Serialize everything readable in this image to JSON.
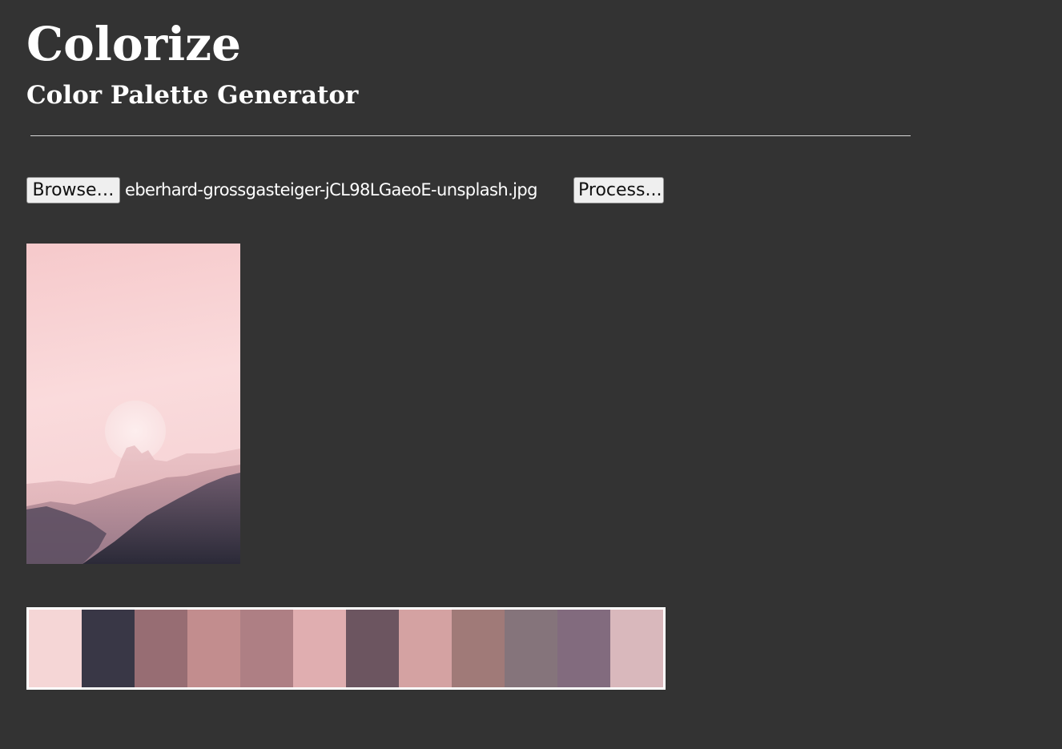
{
  "header": {
    "title": "Colorize",
    "subtitle": "Color Palette Generator"
  },
  "upload": {
    "browse_label": "Browse…",
    "file_name": "eberhard-grossgasteiger-jCL98LGaeoE-unsplash.jpg",
    "process_label": "Process..."
  },
  "preview": {
    "icon": "uploaded-image-preview"
  },
  "palette": {
    "swatches": [
      "#f5d6d6",
      "#393746",
      "#976d73",
      "#c28d8e",
      "#ae7f84",
      "#e0aeb0",
      "#6c5560",
      "#d4a2a2",
      "#a07a78",
      "#85747b",
      "#826b7e",
      "#d9b8bc"
    ]
  }
}
